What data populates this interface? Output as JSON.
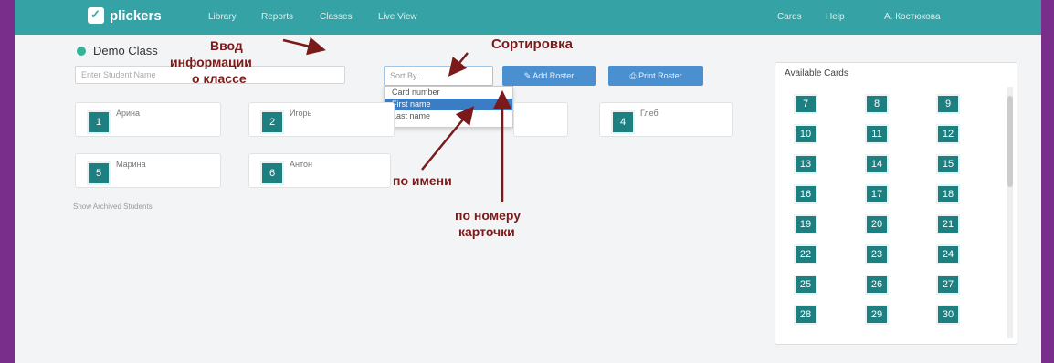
{
  "nav": {
    "logo": "plickers",
    "items": [
      "Library",
      "Reports",
      "Classes",
      "Live View"
    ],
    "right_items": [
      "Cards",
      "Help",
      "A. Костюкова"
    ]
  },
  "class": {
    "name": "Demo Class"
  },
  "inputs": {
    "student_placeholder": "Enter Student Name",
    "sort_placeholder": "Sort By..."
  },
  "sort_options": [
    "Card number",
    "First name",
    "Last name"
  ],
  "buttons": {
    "add_roster": "Add Roster",
    "print_roster": "Print Roster"
  },
  "students": [
    {
      "num": "1",
      "name": "Арина"
    },
    {
      "num": "2",
      "name": "Игорь"
    },
    {
      "num": "4",
      "name": "Глеб"
    },
    {
      "num": "5",
      "name": "Марина"
    },
    {
      "num": "6",
      "name": "Антон"
    }
  ],
  "archived_link": "Show Archived Students",
  "available_cards": {
    "title": "Available Cards",
    "numbers": [
      "7",
      "8",
      "9",
      "10",
      "11",
      "12",
      "13",
      "14",
      "15",
      "16",
      "17",
      "18",
      "19",
      "20",
      "21",
      "22",
      "23",
      "24",
      "25",
      "26",
      "27",
      "28",
      "29",
      "30"
    ]
  },
  "annotations": {
    "input_info_1": "Ввод",
    "input_info_2": "информации",
    "input_info_3": "о классе",
    "sorting": "Сортировка",
    "by_name": "по имени",
    "by_card_1": "по номеру",
    "by_card_2": "карточки"
  },
  "colors": {
    "nav": "#35a3a5",
    "badge": "#1e7f80",
    "button": "#4a90d0",
    "frame": "#7a2e8c",
    "annotation": "#7a1a1a"
  }
}
